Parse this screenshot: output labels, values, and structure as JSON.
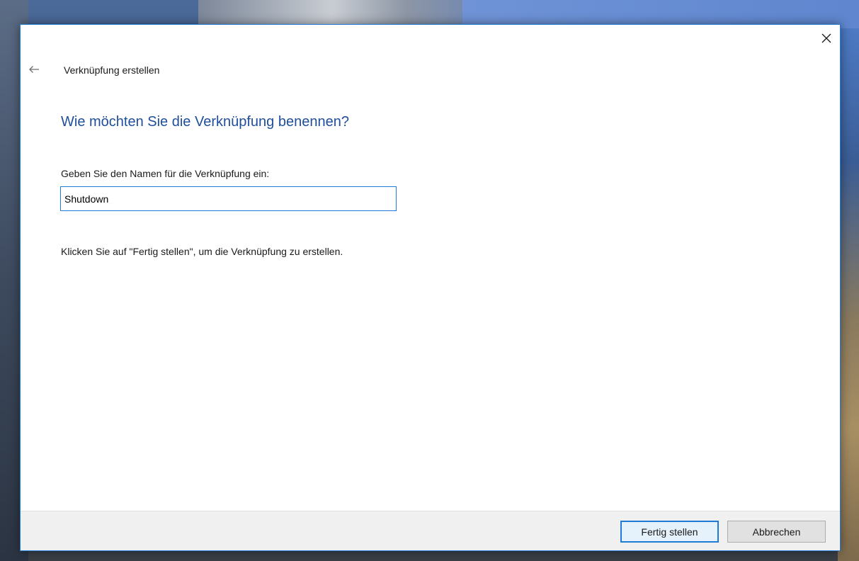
{
  "dialog": {
    "title": "Verknüpfung erstellen",
    "heading": "Wie möchten Sie die Verknüpfung benennen?",
    "field_label": "Geben Sie den Namen für die Verknüpfung ein:",
    "name_value": "Shutdown",
    "instruction": "Klicken Sie auf \"Fertig stellen\", um die Verknüpfung zu erstellen.",
    "finish_label": "Fertig stellen",
    "cancel_label": "Abbrechen"
  },
  "icons": {
    "back": "arrow-left-icon",
    "close": "close-icon"
  },
  "colors": {
    "accent": "#1e7bd6",
    "heading": "#1f4e9c",
    "footer_bg": "#f0f0f0"
  }
}
